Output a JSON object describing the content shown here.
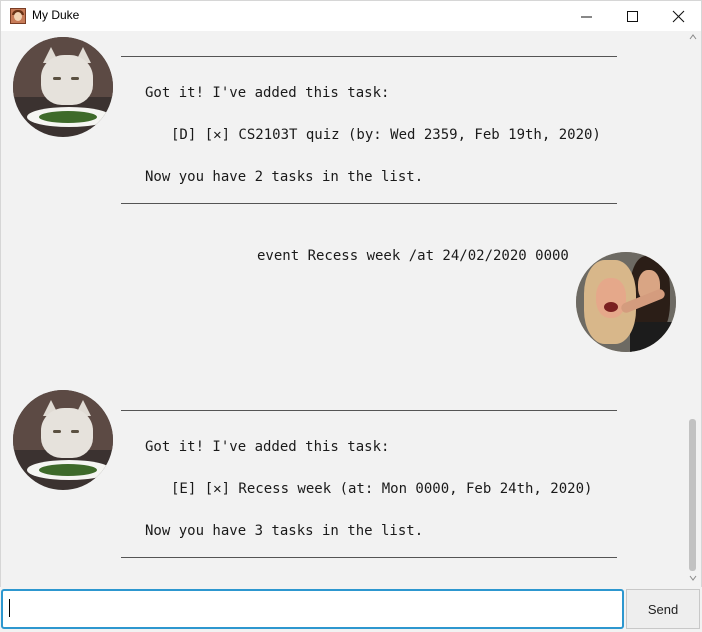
{
  "window": {
    "title": "My Duke",
    "icon": "duke-app-icon"
  },
  "messages": [
    {
      "sender": "duke",
      "rule": "________________________________________________________________",
      "header": "Got it! I've added this task:",
      "task": "[D] [✕] CS2103T quiz (by: Wed 2359, Feb 19th, 2020)",
      "count": "Now you have 2 tasks in the list."
    },
    {
      "sender": "user",
      "text": "event Recess week /at 24/02/2020 0000"
    },
    {
      "sender": "duke",
      "rule": "________________________________________________________________",
      "header": "Got it! I've added this task:",
      "task": "[E] [✕] Recess week (at: Mon 0000, Feb 24th, 2020)",
      "count": "Now you have 3 tasks in the list."
    }
  ],
  "input": {
    "value": "",
    "placeholder": ""
  },
  "send_button": {
    "label": "Send"
  },
  "colors": {
    "accent": "#2d97cf",
    "background": "#f2f2f2"
  }
}
